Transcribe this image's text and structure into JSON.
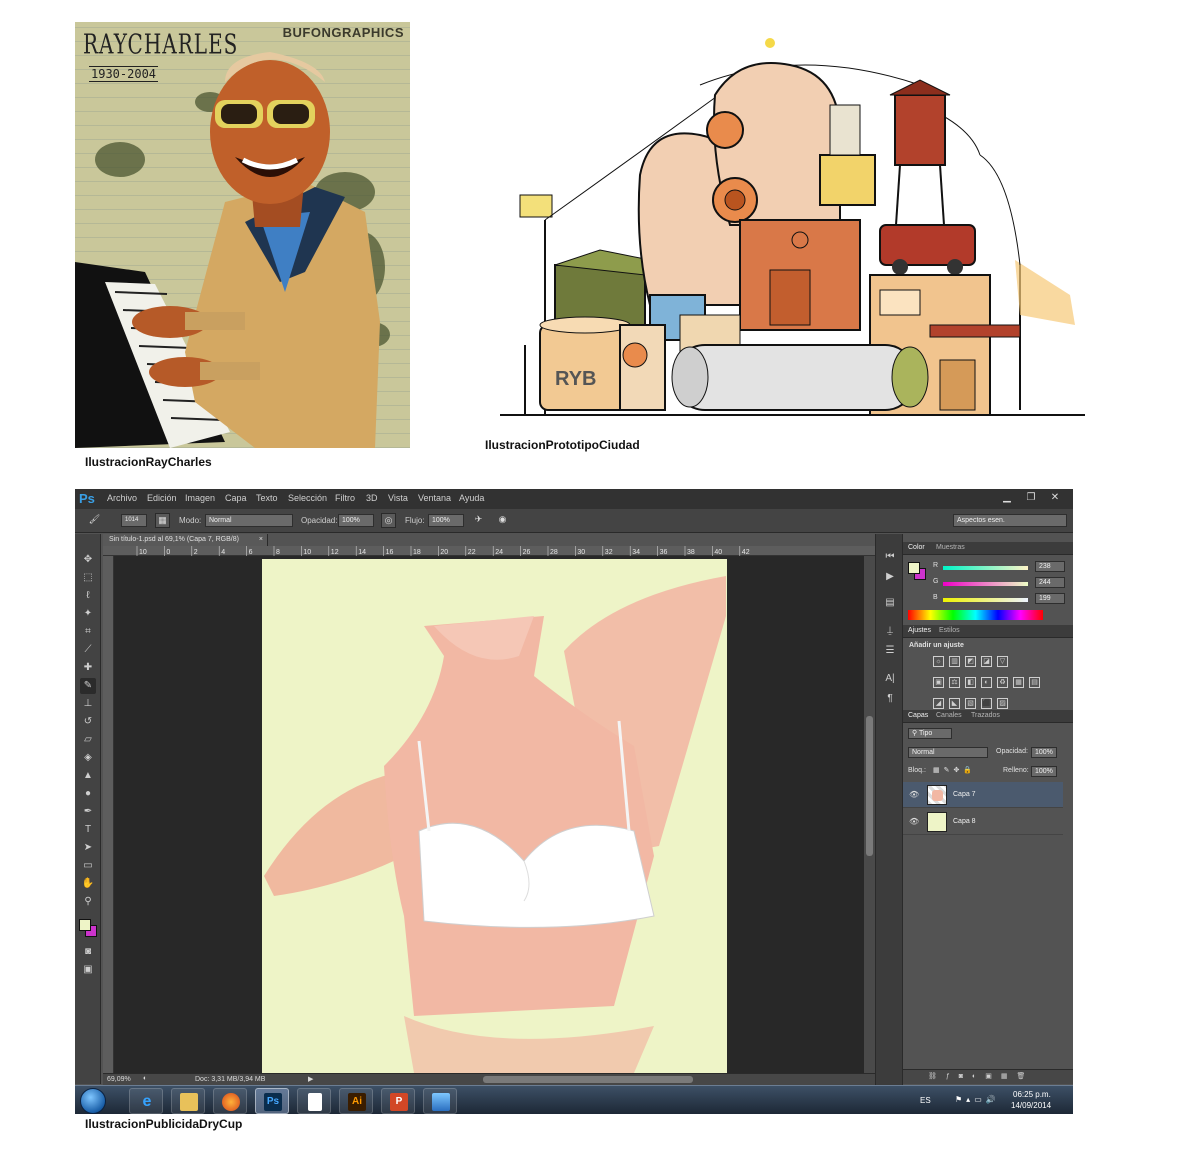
{
  "captions": {
    "ray_charles": "IlustracionRayCharles",
    "city": "IlustracionPrototipoCiudad",
    "drycup": "IlustracionPublicidaDryCup"
  },
  "poster": {
    "title": "RAYCHARLES",
    "years": "1930-2004",
    "brand": "BUFONGRAPHICS"
  },
  "photoshop": {
    "app_logo": "Ps",
    "menu": [
      "Archivo",
      "Edición",
      "Imagen",
      "Capa",
      "Texto",
      "Selección",
      "Filtro",
      "3D",
      "Vista",
      "Ventana",
      "Ayuda"
    ],
    "options": {
      "brush_size": "1014",
      "mode_label": "Modo:",
      "mode_value": "Normal",
      "opacity_label": "Opacidad:",
      "opacity_value": "100%",
      "flow_label": "Flujo:",
      "flow_value": "100%",
      "workspace": "Aspectos esen."
    },
    "document_tab": "Sin título-1.psd al 69,1% (Capa 7, RGB/8)",
    "ruler_marks": [
      "10",
      "0",
      "2",
      "4",
      "6",
      "8",
      "10",
      "12",
      "14",
      "16",
      "18",
      "20",
      "22",
      "24",
      "26",
      "28",
      "30",
      "32",
      "34",
      "36",
      "38",
      "40",
      "42"
    ],
    "status": {
      "zoom": "69,09%",
      "doc": "Doc: 3,31 MB/3,94 MB"
    },
    "color_panel": {
      "tabs": [
        "Color",
        "Muestras"
      ],
      "r_label": "R",
      "r_value": "238",
      "g_label": "G",
      "g_value": "244",
      "b_label": "B",
      "b_value": "199",
      "foreground": "#eef4c7",
      "background": "#cc33cc"
    },
    "adjustments_panel": {
      "tabs": [
        "Ajustes",
        "Estilos"
      ],
      "heading": "Añadir un ajuste"
    },
    "layers_panel": {
      "tabs": [
        "Capas",
        "Canales",
        "Trazados"
      ],
      "filter": "Tipo",
      "blend_mode": "Normal",
      "opacity_label": "Opacidad:",
      "opacity_value": "100%",
      "lock_label": "Bloq.:",
      "fill_label": "Relleno:",
      "fill_value": "100%",
      "layers": [
        {
          "name": "Capa 7",
          "selected": true
        },
        {
          "name": "Capa 8",
          "selected": false
        }
      ]
    }
  },
  "taskbar": {
    "language": "ES",
    "time": "06:25 p.m.",
    "date": "14/09/2014",
    "apps": [
      "internet-explorer",
      "file-explorer",
      "firefox",
      "photoshop",
      "document",
      "illustrator",
      "powerpoint",
      "remote-desktop"
    ]
  }
}
